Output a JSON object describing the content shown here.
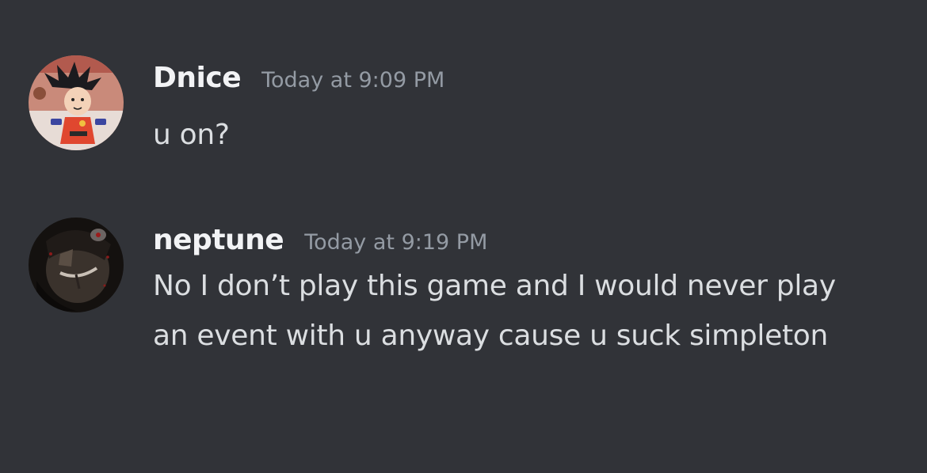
{
  "messages": [
    {
      "username": "Dnice",
      "timestamp": "Today at 9:09 PM",
      "content": "u on?",
      "avatar_icon": "goku-avatar-icon"
    },
    {
      "username": "neptune",
      "timestamp": "Today at 9:19 PM",
      "content": "No I don’t play this game and I would never play an event with u anyway cause u suck simpleton",
      "avatar_icon": "dark-character-avatar-icon"
    }
  ],
  "colors": {
    "background": "#313338",
    "username": "#f2f3f5",
    "timestamp": "#949ba4",
    "text": "#dbdee1"
  }
}
